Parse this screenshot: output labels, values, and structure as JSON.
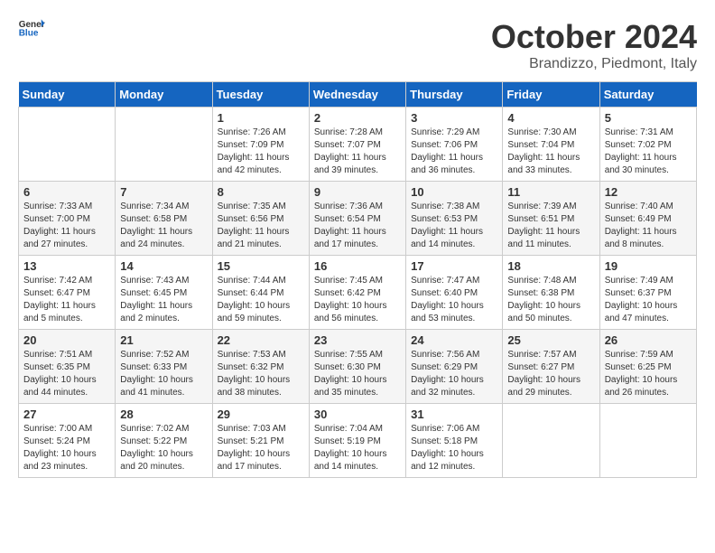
{
  "header": {
    "logo_general": "General",
    "logo_blue": "Blue",
    "month": "October 2024",
    "location": "Brandizzo, Piedmont, Italy"
  },
  "days_of_week": [
    "Sunday",
    "Monday",
    "Tuesday",
    "Wednesday",
    "Thursday",
    "Friday",
    "Saturday"
  ],
  "weeks": [
    [
      {
        "day": "",
        "sunrise": "",
        "sunset": "",
        "daylight": ""
      },
      {
        "day": "",
        "sunrise": "",
        "sunset": "",
        "daylight": ""
      },
      {
        "day": "1",
        "sunrise": "Sunrise: 7:26 AM",
        "sunset": "Sunset: 7:09 PM",
        "daylight": "Daylight: 11 hours and 42 minutes."
      },
      {
        "day": "2",
        "sunrise": "Sunrise: 7:28 AM",
        "sunset": "Sunset: 7:07 PM",
        "daylight": "Daylight: 11 hours and 39 minutes."
      },
      {
        "day": "3",
        "sunrise": "Sunrise: 7:29 AM",
        "sunset": "Sunset: 7:06 PM",
        "daylight": "Daylight: 11 hours and 36 minutes."
      },
      {
        "day": "4",
        "sunrise": "Sunrise: 7:30 AM",
        "sunset": "Sunset: 7:04 PM",
        "daylight": "Daylight: 11 hours and 33 minutes."
      },
      {
        "day": "5",
        "sunrise": "Sunrise: 7:31 AM",
        "sunset": "Sunset: 7:02 PM",
        "daylight": "Daylight: 11 hours and 30 minutes."
      }
    ],
    [
      {
        "day": "6",
        "sunrise": "Sunrise: 7:33 AM",
        "sunset": "Sunset: 7:00 PM",
        "daylight": "Daylight: 11 hours and 27 minutes."
      },
      {
        "day": "7",
        "sunrise": "Sunrise: 7:34 AM",
        "sunset": "Sunset: 6:58 PM",
        "daylight": "Daylight: 11 hours and 24 minutes."
      },
      {
        "day": "8",
        "sunrise": "Sunrise: 7:35 AM",
        "sunset": "Sunset: 6:56 PM",
        "daylight": "Daylight: 11 hours and 21 minutes."
      },
      {
        "day": "9",
        "sunrise": "Sunrise: 7:36 AM",
        "sunset": "Sunset: 6:54 PM",
        "daylight": "Daylight: 11 hours and 17 minutes."
      },
      {
        "day": "10",
        "sunrise": "Sunrise: 7:38 AM",
        "sunset": "Sunset: 6:53 PM",
        "daylight": "Daylight: 11 hours and 14 minutes."
      },
      {
        "day": "11",
        "sunrise": "Sunrise: 7:39 AM",
        "sunset": "Sunset: 6:51 PM",
        "daylight": "Daylight: 11 hours and 11 minutes."
      },
      {
        "day": "12",
        "sunrise": "Sunrise: 7:40 AM",
        "sunset": "Sunset: 6:49 PM",
        "daylight": "Daylight: 11 hours and 8 minutes."
      }
    ],
    [
      {
        "day": "13",
        "sunrise": "Sunrise: 7:42 AM",
        "sunset": "Sunset: 6:47 PM",
        "daylight": "Daylight: 11 hours and 5 minutes."
      },
      {
        "day": "14",
        "sunrise": "Sunrise: 7:43 AM",
        "sunset": "Sunset: 6:45 PM",
        "daylight": "Daylight: 11 hours and 2 minutes."
      },
      {
        "day": "15",
        "sunrise": "Sunrise: 7:44 AM",
        "sunset": "Sunset: 6:44 PM",
        "daylight": "Daylight: 10 hours and 59 minutes."
      },
      {
        "day": "16",
        "sunrise": "Sunrise: 7:45 AM",
        "sunset": "Sunset: 6:42 PM",
        "daylight": "Daylight: 10 hours and 56 minutes."
      },
      {
        "day": "17",
        "sunrise": "Sunrise: 7:47 AM",
        "sunset": "Sunset: 6:40 PM",
        "daylight": "Daylight: 10 hours and 53 minutes."
      },
      {
        "day": "18",
        "sunrise": "Sunrise: 7:48 AM",
        "sunset": "Sunset: 6:38 PM",
        "daylight": "Daylight: 10 hours and 50 minutes."
      },
      {
        "day": "19",
        "sunrise": "Sunrise: 7:49 AM",
        "sunset": "Sunset: 6:37 PM",
        "daylight": "Daylight: 10 hours and 47 minutes."
      }
    ],
    [
      {
        "day": "20",
        "sunrise": "Sunrise: 7:51 AM",
        "sunset": "Sunset: 6:35 PM",
        "daylight": "Daylight: 10 hours and 44 minutes."
      },
      {
        "day": "21",
        "sunrise": "Sunrise: 7:52 AM",
        "sunset": "Sunset: 6:33 PM",
        "daylight": "Daylight: 10 hours and 41 minutes."
      },
      {
        "day": "22",
        "sunrise": "Sunrise: 7:53 AM",
        "sunset": "Sunset: 6:32 PM",
        "daylight": "Daylight: 10 hours and 38 minutes."
      },
      {
        "day": "23",
        "sunrise": "Sunrise: 7:55 AM",
        "sunset": "Sunset: 6:30 PM",
        "daylight": "Daylight: 10 hours and 35 minutes."
      },
      {
        "day": "24",
        "sunrise": "Sunrise: 7:56 AM",
        "sunset": "Sunset: 6:29 PM",
        "daylight": "Daylight: 10 hours and 32 minutes."
      },
      {
        "day": "25",
        "sunrise": "Sunrise: 7:57 AM",
        "sunset": "Sunset: 6:27 PM",
        "daylight": "Daylight: 10 hours and 29 minutes."
      },
      {
        "day": "26",
        "sunrise": "Sunrise: 7:59 AM",
        "sunset": "Sunset: 6:25 PM",
        "daylight": "Daylight: 10 hours and 26 minutes."
      }
    ],
    [
      {
        "day": "27",
        "sunrise": "Sunrise: 7:00 AM",
        "sunset": "Sunset: 5:24 PM",
        "daylight": "Daylight: 10 hours and 23 minutes."
      },
      {
        "day": "28",
        "sunrise": "Sunrise: 7:02 AM",
        "sunset": "Sunset: 5:22 PM",
        "daylight": "Daylight: 10 hours and 20 minutes."
      },
      {
        "day": "29",
        "sunrise": "Sunrise: 7:03 AM",
        "sunset": "Sunset: 5:21 PM",
        "daylight": "Daylight: 10 hours and 17 minutes."
      },
      {
        "day": "30",
        "sunrise": "Sunrise: 7:04 AM",
        "sunset": "Sunset: 5:19 PM",
        "daylight": "Daylight: 10 hours and 14 minutes."
      },
      {
        "day": "31",
        "sunrise": "Sunrise: 7:06 AM",
        "sunset": "Sunset: 5:18 PM",
        "daylight": "Daylight: 10 hours and 12 minutes."
      },
      {
        "day": "",
        "sunrise": "",
        "sunset": "",
        "daylight": ""
      },
      {
        "day": "",
        "sunrise": "",
        "sunset": "",
        "daylight": ""
      }
    ]
  ]
}
